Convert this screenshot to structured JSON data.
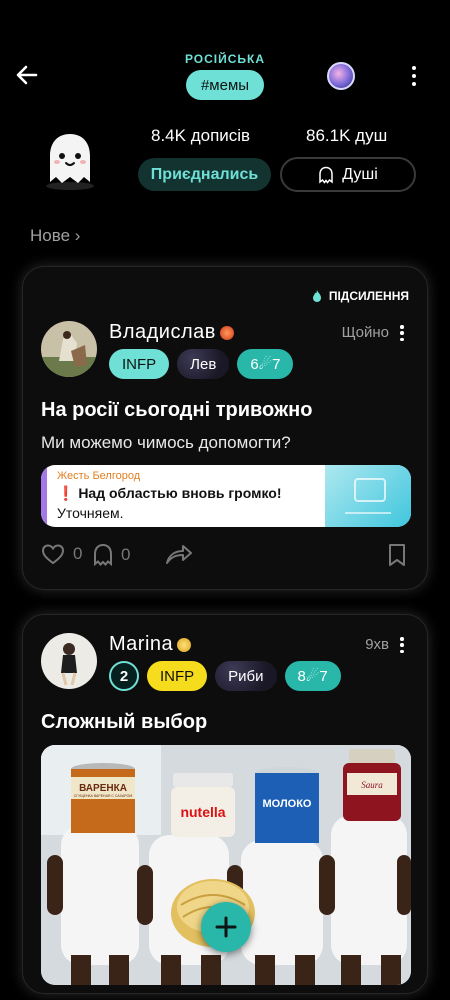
{
  "header": {
    "community_name": "РОСІЙСЬКА",
    "tag": "#мемы",
    "stats": {
      "posts": "8.4K дописів",
      "souls": "86.1K душ"
    },
    "join_label": "Приєднались",
    "souls_label": "Душі"
  },
  "feed": {
    "section_label": "Нове ›"
  },
  "posts": [
    {
      "boost_label": "ПІДСИЛЕННЯ",
      "author": "Владислав",
      "time": "Щойно",
      "chips": [
        "INFP",
        "Лев",
        "6☄7"
      ],
      "title": "На росії сьогодні тривожно",
      "body": "Ми можемо чимось допомогти?",
      "link_preview": {
        "source": "Жесть Белгород",
        "title": "❗ Над областью вновь громко!",
        "text": "Уточняем."
      },
      "likes": "0",
      "souls": "0"
    },
    {
      "author": "Marina",
      "time": "9хв",
      "level": "2",
      "chips": [
        "INFP",
        "Риби",
        "8☄7"
      ],
      "title": "Сложный выбор",
      "meme_labels": {
        "jar1": "ВАРЕНКА",
        "jar1_sub": "СГУЩЕНКА ВАРЕНАЯ С САХАРОМ",
        "jar2": "nutella",
        "jar3": "МОЛОКО",
        "jar4": "Saura"
      }
    }
  ],
  "colors": {
    "accent": "#6fe0d6",
    "accent_dark": "#29b7aa",
    "yellow": "#f5dd1e",
    "background": "#000000"
  }
}
